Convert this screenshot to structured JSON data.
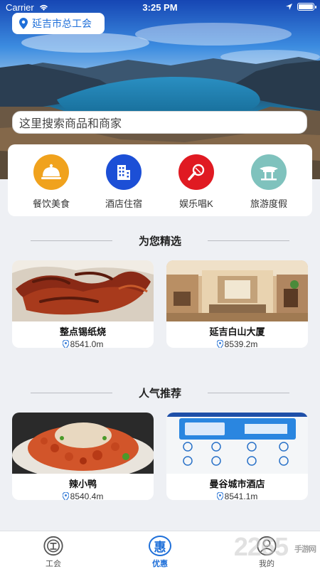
{
  "status_bar": {
    "carrier": "Carrier",
    "time": "3:25 PM"
  },
  "header": {
    "location": "延吉市总工会"
  },
  "search": {
    "placeholder": "这里搜索商品和商家"
  },
  "categories": [
    {
      "label": "餐饮美食",
      "icon": "food-cloche-icon",
      "color": "#f0a21d"
    },
    {
      "label": "酒店住宿",
      "icon": "hotel-building-icon",
      "color": "#1c4fd6"
    },
    {
      "label": "娱乐唱K",
      "icon": "microphone-icon",
      "color": "#e01a22"
    },
    {
      "label": "旅游度假",
      "icon": "pavilion-icon",
      "color": "#7fc2bd"
    }
  ],
  "sections": {
    "featured_title": "为您精选",
    "popular_title": "人气推荐"
  },
  "featured": [
    {
      "name": "整点锡纸烧",
      "distance": "8541.0m"
    },
    {
      "name": "延吉白山大厦",
      "distance": "8539.2m"
    }
  ],
  "popular": [
    {
      "name": "辣小鸭",
      "distance": "8540.4m"
    },
    {
      "name": "曼谷城市酒店",
      "distance": "8541.1m"
    }
  ],
  "tabs": [
    {
      "label": "工会",
      "icon": "union-emblem-icon",
      "active": false
    },
    {
      "label": "优惠",
      "icon": "discount-hui-icon",
      "active": true,
      "glyph": "惠"
    },
    {
      "label": "我的",
      "icon": "profile-icon",
      "active": false
    }
  ],
  "watermark": {
    "text": "2265",
    "sub": "手游网"
  },
  "colors": {
    "accent": "#1e6fd9",
    "tab_inactive": "#555555"
  }
}
